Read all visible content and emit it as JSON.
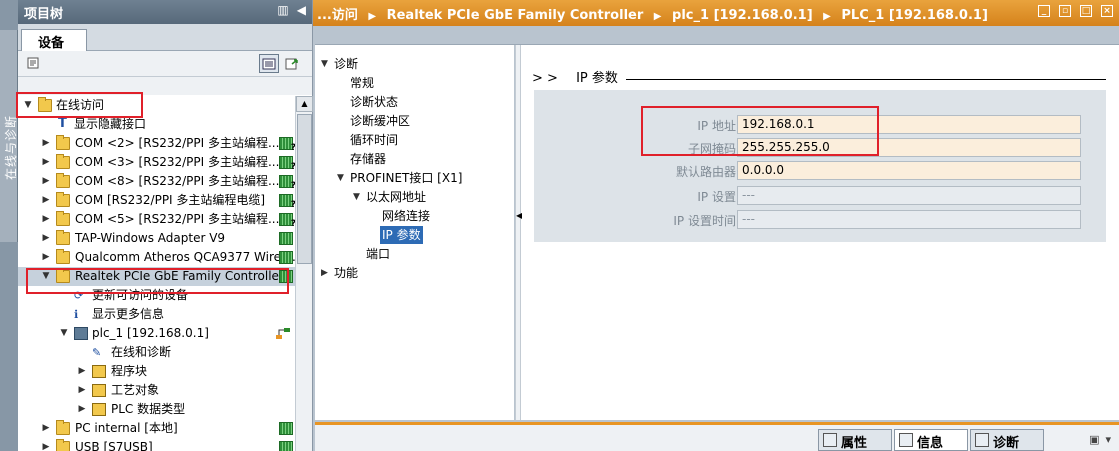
{
  "side_strip": {
    "label": "在线与诊断"
  },
  "tree_panel": {
    "title": "项目树",
    "tab": "设备",
    "items": [
      {
        "label": "在线访问",
        "level": 0,
        "expander": "▼",
        "icon": "folder",
        "net": ""
      },
      {
        "label": "显示隐藏接口",
        "level": 1,
        "expander": "",
        "icon": "blue-t",
        "net": ""
      },
      {
        "label": "COM <2> [RS232/PPI 多主站编程...",
        "level": 1,
        "expander": "▶",
        "icon": "folder",
        "net": "q"
      },
      {
        "label": "COM <3> [RS232/PPI 多主站编程...",
        "level": 1,
        "expander": "▶",
        "icon": "folder",
        "net": "q"
      },
      {
        "label": "COM <8> [RS232/PPI 多主站编程...",
        "level": 1,
        "expander": "▶",
        "icon": "folder",
        "net": "q"
      },
      {
        "label": "COM [RS232/PPI 多主站编程电缆]",
        "level": 1,
        "expander": "▶",
        "icon": "folder",
        "net": "q"
      },
      {
        "label": "COM <5> [RS232/PPI 多主站编程...",
        "level": 1,
        "expander": "▶",
        "icon": "folder",
        "net": "q"
      },
      {
        "label": "TAP-Windows Adapter V9",
        "level": 1,
        "expander": "▶",
        "icon": "folder",
        "net": "plain"
      },
      {
        "label": "Qualcomm Atheros QCA9377 Wirel...",
        "level": 1,
        "expander": "▶",
        "icon": "folder",
        "net": "plain"
      },
      {
        "label": "Realtek PCIe GbE Family Controller",
        "level": 1,
        "expander": "▼",
        "icon": "folder",
        "net": "plain",
        "selected": true
      },
      {
        "label": "更新可访问的设备",
        "level": 2,
        "expander": "",
        "icon": "update",
        "net": ""
      },
      {
        "label": "显示更多信息",
        "level": 2,
        "expander": "",
        "icon": "info",
        "net": ""
      },
      {
        "label": "plc_1 [192.168.0.1]",
        "level": 2,
        "expander": "▼",
        "icon": "plc",
        "net": "link"
      },
      {
        "label": "在线和诊断",
        "level": 3,
        "expander": "",
        "icon": "diag",
        "net": ""
      },
      {
        "label": "程序块",
        "level": 3,
        "expander": "▶",
        "icon": "blocks",
        "net": ""
      },
      {
        "label": "工艺对象",
        "level": 3,
        "expander": "▶",
        "icon": "tech",
        "net": ""
      },
      {
        "label": "PLC 数据类型",
        "level": 3,
        "expander": "▶",
        "icon": "types",
        "net": ""
      },
      {
        "label": "PC internal [本地]",
        "level": 1,
        "expander": "▶",
        "icon": "folder",
        "net": "plain"
      },
      {
        "label": "USB [S7USB]",
        "level": 1,
        "expander": "▶",
        "icon": "folder",
        "net": "plain"
      }
    ]
  },
  "title_bar": {
    "crumbs": [
      "...访问",
      "Realtek PCIe GbE Family Controller",
      "plc_1 [192.168.0.1]",
      "PLC_1 [192.168.0.1]"
    ],
    "separator": "▶"
  },
  "nav": {
    "diag": "诊断",
    "general": "常规",
    "diag_status": "诊断状态",
    "diag_buffer": "诊断缓冲区",
    "cycle_time": "循环时间",
    "memory": "存储器",
    "profinet": "PROFINET接口 [X1]",
    "ethernet": "以太网地址",
    "network": "网络连接",
    "ip_params": "IP 参数",
    "port": "端口",
    "functions": "功能"
  },
  "detail": {
    "section_arrows": "> >",
    "section_title": "IP 参数",
    "fields": [
      {
        "label": "IP 地址:",
        "value": "192.168.0.1",
        "editable": true
      },
      {
        "label": "子网掩码:",
        "value": "255.255.255.0",
        "editable": true
      },
      {
        "label": "默认路由器:",
        "value": "0.0.0.0",
        "editable": true
      },
      {
        "label": "IP 设置:",
        "value": "---",
        "editable": false
      },
      {
        "label": "IP 设置时间:",
        "value": "---",
        "editable": false
      }
    ]
  },
  "bottom_tabs": {
    "properties": "属性",
    "info": "信息",
    "diagnostics": "诊断"
  },
  "colors": {
    "title_orange": "#d5821b",
    "highlight_red": "#e0202a",
    "selection_blue": "#2d6bb5",
    "editable_field": "#fbeedc"
  }
}
